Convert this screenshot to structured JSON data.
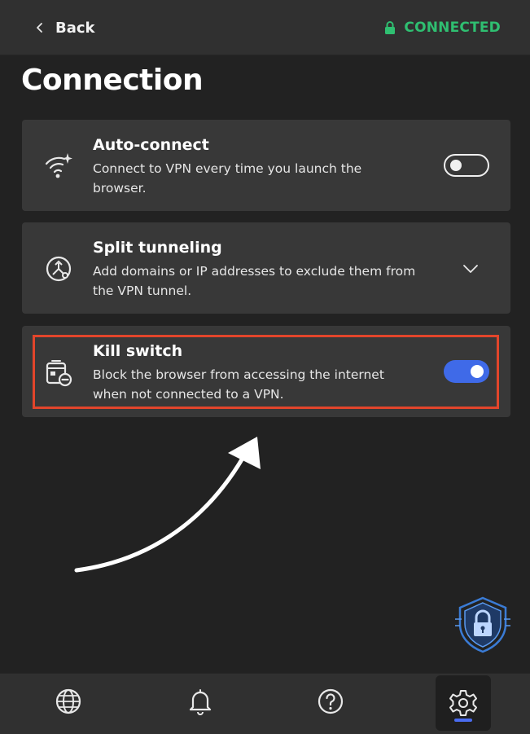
{
  "header": {
    "back_label": "Back",
    "status_label": "CONNECTED",
    "status_color": "#2fbf71"
  },
  "page": {
    "title": "Connection"
  },
  "settings": [
    {
      "title": "Auto-connect",
      "description": "Connect to VPN every time you launch the browser.",
      "icon": "wifi-sparkle-icon",
      "control": "toggle",
      "enabled": false
    },
    {
      "title": "Split tunneling",
      "description": "Add domains or IP addresses to exclude them from the VPN tunnel.",
      "icon": "split-tunnel-icon",
      "control": "chevron-down-icon"
    },
    {
      "title": "Kill switch",
      "description": "Block the browser from accessing the internet when not connected to a VPN.",
      "icon": "kill-switch-icon",
      "control": "toggle",
      "enabled": true,
      "highlighted": true
    }
  ],
  "colors": {
    "accent": "#3f6ae8",
    "highlight": "#e2452b"
  },
  "nav": {
    "items": [
      "globe-icon",
      "bell-icon",
      "help-icon",
      "gear-icon"
    ],
    "active": "gear-icon"
  }
}
